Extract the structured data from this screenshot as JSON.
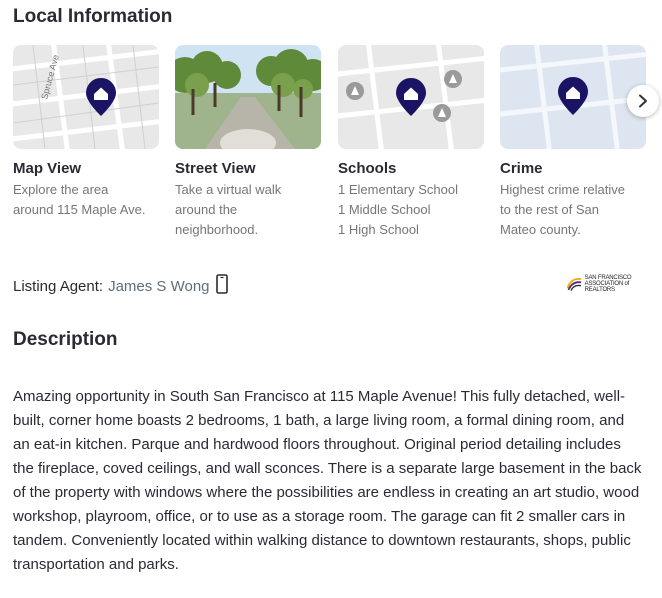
{
  "local_info": {
    "title": "Local Information",
    "cards": [
      {
        "title": "Map View",
        "lines": [
          "Explore the area",
          "around 115 Maple Ave."
        ],
        "map_label": "Spruce Ave"
      },
      {
        "title": "Street View",
        "lines": [
          "Take a virtual walk",
          "around the",
          "neighborhood."
        ]
      },
      {
        "title": "Schools",
        "lines": [
          "1 Elementary School",
          "1 Middle School",
          "1 High School"
        ]
      },
      {
        "title": "Crime",
        "lines": [
          "Highest crime relative",
          "to the rest of San",
          "Mateo county."
        ]
      }
    ],
    "next_icon": "chevron-right-icon"
  },
  "agent": {
    "label": "Listing Agent:",
    "name": "James S Wong",
    "phone_icon": "phone-icon",
    "logo_lines": [
      "SAN FRANCISCO",
      "ASSOCIATION of REALTORS"
    ]
  },
  "description": {
    "title": "Description",
    "text": "Amazing opportunity in South San Francisco at 115 Maple Avenue! This fully detached, well-built, corner home boasts 2 bedrooms, 1 bath, a large living room, a formal dining room, and an eat-in kitchen. Parque and hardwood floors throughout. Original period detailing includes the fireplace, coved ceilings, and wall sconces. There is a separate large basement in the back of the property with windows where the possibilities are endless in creating an art studio, wood workshop, playroom, office, or to use as a storage room. The garage can fit 2 smaller cars in tandem. Conveniently located within walking distance to downtown restaurants, shops, public transportation and parks."
  },
  "colors": {
    "pin": "#1b1464",
    "link": "#5f6e7a",
    "muted": "#767676",
    "map_bg": "#e6e6e6",
    "crime_bg": "#dde6f0"
  }
}
